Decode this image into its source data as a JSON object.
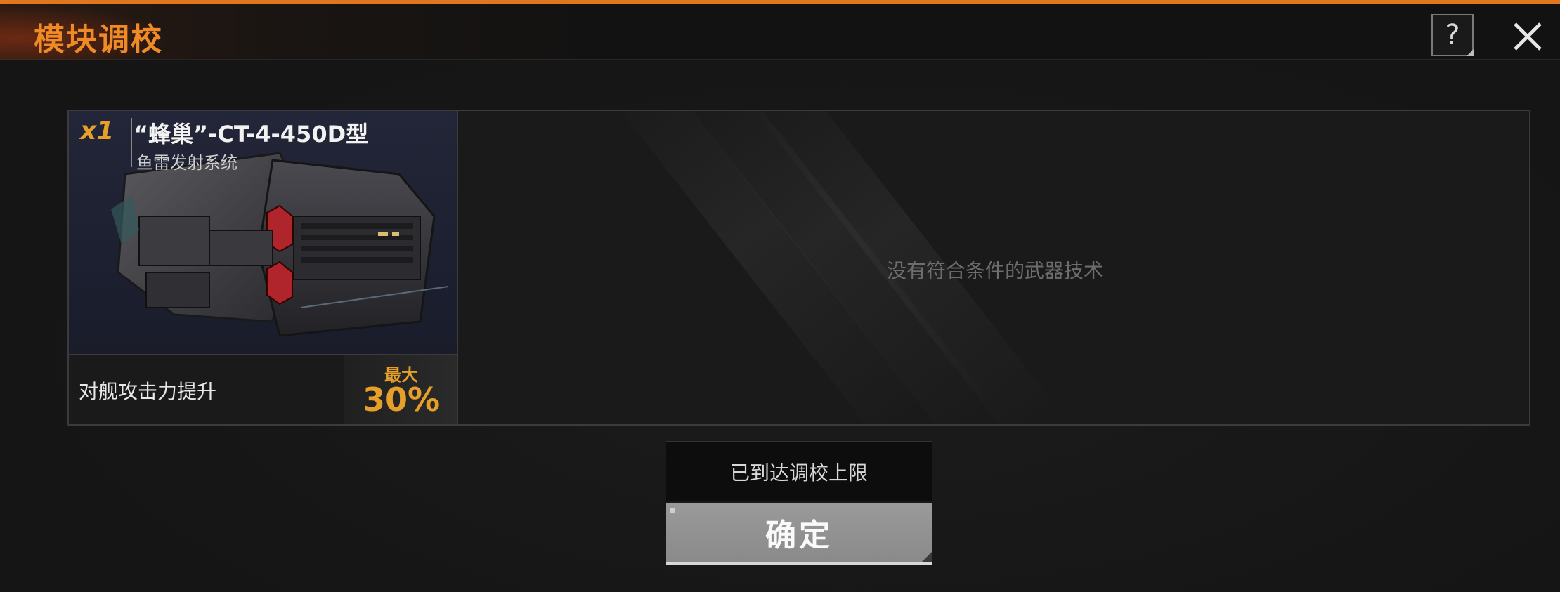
{
  "header": {
    "title": "模块调校",
    "help_glyph": "?",
    "help_icon": "question-icon",
    "close_icon": "close-icon"
  },
  "module_card": {
    "quantity": "x1",
    "name": "“蜂巢”-CT-4-450D型",
    "category": "鱼雷发射系统",
    "bonus_label": "对舰攻击力提升",
    "bonus_max_label": "最大",
    "bonus_value": "30%"
  },
  "tech_panel": {
    "empty_message": "没有符合条件的武器技术"
  },
  "footer": {
    "notice": "已到达调校上限",
    "confirm_label": "确定"
  },
  "colors": {
    "accent": "#ef8a25",
    "bonus": "#e6a02a",
    "background": "#151515"
  }
}
